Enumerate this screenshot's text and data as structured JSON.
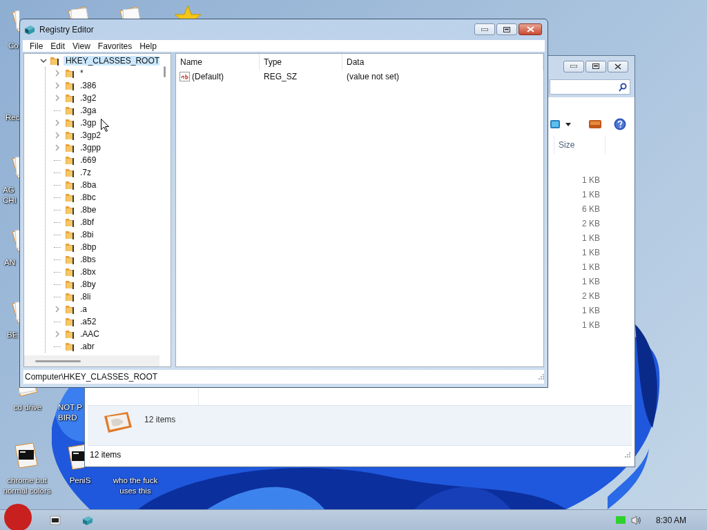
{
  "desktop_icons": [
    {
      "kind": "document",
      "lines": [
        "Co"
      ]
    },
    {
      "kind": "document"
    },
    {
      "kind": "document"
    },
    {
      "kind": "star"
    },
    {
      "kind": "none",
      "lines": [
        "Rec"
      ]
    },
    {
      "kind": "document",
      "lines": [
        "AG",
        "CHI"
      ]
    },
    {
      "kind": "document",
      "lines": [
        "AN"
      ]
    },
    {
      "kind": "document",
      "lines": [
        "BE"
      ]
    },
    {
      "kind": "document",
      "lines": [
        "cd drive"
      ]
    },
    {
      "kind": "none",
      "lines": [
        "NOT P",
        "BIRD"
      ]
    },
    {
      "kind": "terminal",
      "lines": [
        "chrome but",
        "normal colors"
      ]
    },
    {
      "kind": "terminal",
      "lines": [
        "PeniS"
      ]
    },
    {
      "kind": "none",
      "lines": [
        "who the fuck",
        "uses this"
      ]
    }
  ],
  "explorer_window": {
    "size_column": "Size",
    "sizes": [
      "1 KB",
      "1 KB",
      "6 KB",
      "2 KB",
      "1 KB",
      "1 KB",
      "1 KB",
      "1 KB",
      "2 KB",
      "1 KB",
      "1 KB"
    ],
    "details_text": "12 items",
    "status_text": "12 items"
  },
  "registry_editor": {
    "title": "Registry Editor",
    "menu": [
      "File",
      "Edit",
      "View",
      "Favorites",
      "Help"
    ],
    "tree": {
      "label": "HKEY_CLASSES_ROOT",
      "expanded": true,
      "selected": true,
      "children": [
        {
          "label": "*",
          "expandable": true,
          "selected": false
        },
        {
          "label": ".386",
          "expandable": true,
          "selected": false
        },
        {
          "label": ".3g2",
          "expandable": true,
          "selected": false
        },
        {
          "label": ".3ga",
          "expandable": false,
          "selected": false
        },
        {
          "label": ".3gp",
          "expandable": true,
          "selected": false
        },
        {
          "label": ".3gp2",
          "expandable": true,
          "selected": false
        },
        {
          "label": ".3gpp",
          "expandable": true,
          "selected": false
        },
        {
          "label": ".669",
          "expandable": false,
          "selected": false
        },
        {
          "label": ".7z",
          "expandable": false,
          "selected": false
        },
        {
          "label": ".8ba",
          "expandable": false,
          "selected": false
        },
        {
          "label": ".8bc",
          "expandable": false,
          "selected": false
        },
        {
          "label": ".8be",
          "expandable": false,
          "selected": false
        },
        {
          "label": ".8bf",
          "expandable": false,
          "selected": false
        },
        {
          "label": ".8bi",
          "expandable": false,
          "selected": false
        },
        {
          "label": ".8bp",
          "expandable": false,
          "selected": false
        },
        {
          "label": ".8bs",
          "expandable": false,
          "selected": false
        },
        {
          "label": ".8bx",
          "expandable": false,
          "selected": false
        },
        {
          "label": ".8by",
          "expandable": false,
          "selected": false
        },
        {
          "label": ".8li",
          "expandable": false,
          "selected": false
        },
        {
          "label": ".a",
          "expandable": true,
          "selected": false
        },
        {
          "label": ".a52",
          "expandable": false,
          "selected": false
        },
        {
          "label": ".AAC",
          "expandable": true,
          "selected": false
        },
        {
          "label": ".abr",
          "expandable": false,
          "selected": false
        }
      ]
    },
    "columns": [
      "Name",
      "Type",
      "Data"
    ],
    "values": [
      {
        "name": "(Default)",
        "type": "REG_SZ",
        "data": "(value not set)"
      }
    ],
    "status_path": "Computer\\HKEY_CLASSES_ROOT"
  },
  "taskbar": {
    "clock": "8:30 AM"
  }
}
